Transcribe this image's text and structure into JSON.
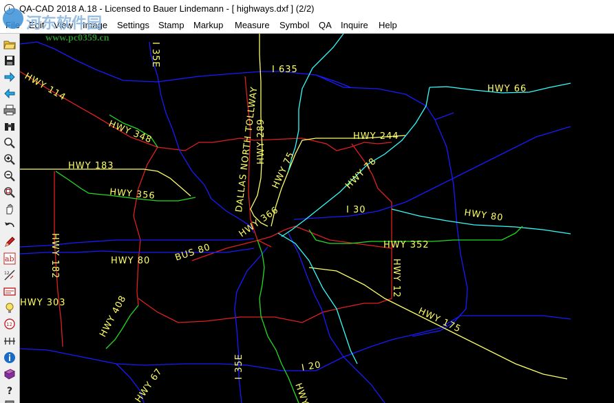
{
  "window": {
    "title": "QA-CAD 2018 A.18 - Licensed to Bauer Lindemann  -  [ highways.dxf ] (2/2)"
  },
  "menu": [
    "File",
    "Edit",
    "View",
    "Image",
    "Settings",
    "Stamp",
    "Markup",
    "Measure",
    "Symbol",
    "QA",
    "Inquire",
    "Help"
  ],
  "toolbar": {
    "tools": [
      "open-icon",
      "save-icon",
      "next-icon",
      "previous-icon",
      "print-icon",
      "binoculars-icon",
      "zoom-icon",
      "zoom-in-icon",
      "zoom-out-icon",
      "zoom-window-icon",
      "pan-hand-icon",
      "undo-icon",
      "pencil-icon",
      "text-icon",
      "dimension-icon",
      "stamp-icon",
      "bulb-icon",
      "numbered-balloon-icon",
      "measure-icon",
      "info-icon",
      "book-icon",
      "help-icon",
      "last-icon"
    ]
  },
  "watermark": {
    "site": "河东软件园",
    "url": "www.pc0359.cn"
  },
  "map": {
    "colors": {
      "red": "#e02020",
      "blue": "#1a1aff",
      "yellow": "#ffff66",
      "cyan": "#33ffff",
      "green": "#22dd22",
      "bg": "#000000"
    },
    "labels": [
      "I 35E",
      "I 635",
      "DALLAS NORTH TOLLWAY",
      "HWY 289",
      "HWY 75",
      "HWY 66",
      "HWY 114",
      "HWY 348",
      "HWY 244",
      "HWY 183",
      "HWY 356",
      "HWY 78",
      "I 30",
      "HWY 80",
      "HWY 182",
      "BUS 80",
      "HWY 80",
      "HWY 366",
      "HWY 352",
      "HWY 12",
      "HWY 303",
      "HWY 408",
      "HWY 175",
      "I 35E",
      "I 20",
      "HWY 67",
      "HWY"
    ]
  }
}
